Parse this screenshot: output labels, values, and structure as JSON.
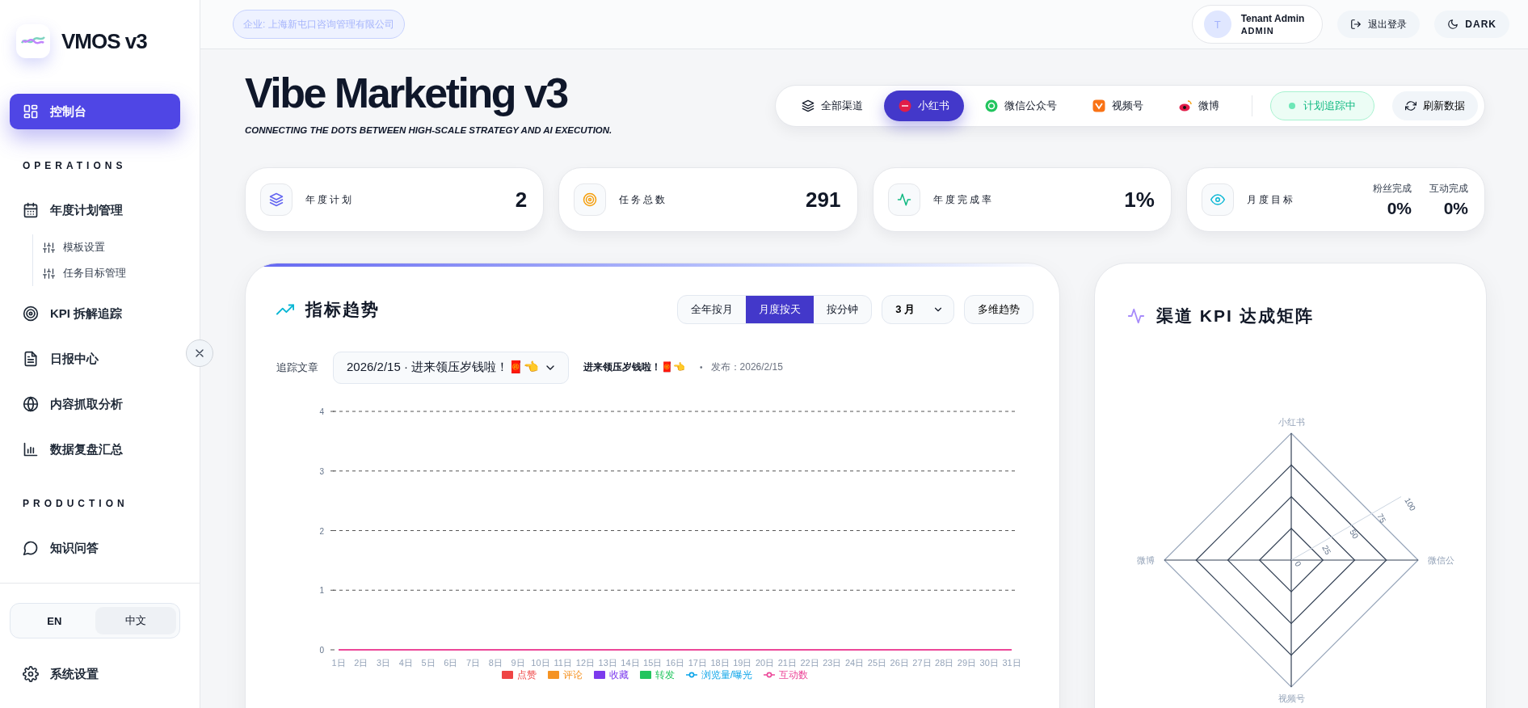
{
  "sidebar": {
    "logo": {
      "text": "VMOS v3"
    },
    "nav": [
      {
        "kind": "item",
        "label": "控制台",
        "selected": true
      },
      {
        "kind": "section",
        "label": "OPERATIONS"
      },
      {
        "kind": "item",
        "label": "年度计划管理",
        "selected": false,
        "children": [
          {
            "label": "模板设置",
            "selected": false
          },
          {
            "label": "任务目标管理",
            "selected": false
          }
        ]
      },
      {
        "kind": "item",
        "label": "KPI 拆解追踪",
        "selected": false
      },
      {
        "kind": "item",
        "label": "日报中心",
        "selected": false
      },
      {
        "kind": "item",
        "label": "内容抓取分析",
        "selected": false
      },
      {
        "kind": "item",
        "label": "数据复盘汇总",
        "selected": false
      },
      {
        "kind": "section",
        "label": "PRODUCTION"
      },
      {
        "kind": "item",
        "label": "知识问答",
        "selected": false
      }
    ],
    "languages": [
      {
        "label": "EN",
        "selected": false
      },
      {
        "label": "中文",
        "selected": true
      }
    ],
    "settings": {
      "label": "系统设置"
    }
  },
  "header": {
    "company": "企业: 上海新屯口咨询管理有限公司",
    "user": {
      "avatar": "T",
      "name": "Tenant Admin",
      "role": "ADMIN"
    },
    "logout": "退出登录",
    "theme": "DARK"
  },
  "hero": {
    "title": "Vibe Marketing v3",
    "subtitle": "CONNECTING THE DOTS BETWEEN HIGH-SCALE STRATEGY AND AI EXECUTION."
  },
  "channels": [
    {
      "label": "全部渠道",
      "selected": false
    },
    {
      "label": "小红书",
      "selected": true
    },
    {
      "label": "微信公众号",
      "selected": false
    },
    {
      "label": "视频号",
      "selected": false
    },
    {
      "label": "微博",
      "selected": false
    }
  ],
  "status": "计划追踪中",
  "refresh": "刷新数据",
  "stats": [
    {
      "kind": "single",
      "label": "年度计划",
      "value": "2"
    },
    {
      "kind": "single",
      "label": "任务总数",
      "value": "291"
    },
    {
      "kind": "single",
      "label": "年度完成率",
      "value": "1%"
    },
    {
      "kind": "split",
      "label": "月度目标",
      "parts": [
        {
          "label": "粉丝完成",
          "value": "0%"
        },
        {
          "label": "互动完成",
          "value": "0%"
        }
      ]
    }
  ],
  "trend": {
    "title": "指标趋势",
    "modes": [
      {
        "label": "全年按月",
        "selected": false
      },
      {
        "label": "月度按天",
        "selected": true
      },
      {
        "label": "按分钟",
        "selected": false
      }
    ],
    "month": "3 月",
    "multi": "多维趋势",
    "article": {
      "label": "追踪文章",
      "value": "2026/2/15 · 进来领压岁钱啦！🧧👈",
      "title": "进来领压岁钱啦！🧧👈",
      "separator": "•",
      "published": "发布：2026/2/15"
    },
    "chart_data": {
      "type": "line",
      "grid": true,
      "categories": [
        "1日",
        "2日",
        "3日",
        "4日",
        "5日",
        "6日",
        "7日",
        "8日",
        "9日",
        "10日",
        "11日",
        "12日",
        "13日",
        "14日",
        "15日",
        "16日",
        "17日",
        "18日",
        "19日",
        "20日",
        "21日",
        "22日",
        "23日",
        "24日",
        "25日",
        "26日",
        "27日",
        "28日",
        "29日",
        "30日",
        "31日"
      ],
      "ylim": [
        0,
        4
      ],
      "yticks": [
        0,
        1,
        2,
        3,
        4
      ],
      "series": [
        {
          "name": "点赞",
          "color": "#ef4444",
          "values": [
            null,
            null,
            null,
            null,
            null,
            null,
            null,
            null,
            null,
            null,
            null,
            null,
            null,
            null,
            null,
            null,
            null,
            null,
            null,
            null,
            null,
            null,
            null,
            null,
            null,
            null,
            null,
            null,
            null,
            null,
            null
          ]
        },
        {
          "name": "评论",
          "color": "#f59323",
          "values": [
            null,
            null,
            null,
            null,
            null,
            null,
            null,
            null,
            null,
            null,
            null,
            null,
            null,
            null,
            null,
            null,
            null,
            null,
            null,
            null,
            null,
            null,
            null,
            null,
            null,
            null,
            null,
            null,
            null,
            null,
            null
          ]
        },
        {
          "name": "收藏",
          "color": "#7c3aed",
          "values": [
            null,
            null,
            null,
            null,
            null,
            null,
            null,
            null,
            null,
            null,
            null,
            null,
            null,
            null,
            null,
            null,
            null,
            null,
            null,
            null,
            null,
            null,
            null,
            null,
            null,
            null,
            null,
            null,
            null,
            null,
            null
          ]
        },
        {
          "name": "转发",
          "color": "#22c55e",
          "values": [
            null,
            null,
            null,
            null,
            null,
            null,
            null,
            null,
            null,
            null,
            null,
            null,
            null,
            null,
            null,
            null,
            null,
            null,
            null,
            null,
            null,
            null,
            null,
            null,
            null,
            null,
            null,
            null,
            null,
            null,
            null
          ]
        },
        {
          "name": "浏览量/曝光",
          "color": "#0ea5e9",
          "values": [
            null,
            null,
            null,
            null,
            null,
            null,
            null,
            null,
            null,
            null,
            null,
            null,
            null,
            null,
            null,
            null,
            null,
            null,
            null,
            null,
            null,
            null,
            null,
            null,
            null,
            null,
            null,
            null,
            null,
            null,
            null
          ]
        },
        {
          "name": "互动数",
          "color": "#ec4899",
          "values": [
            0,
            0,
            0,
            0,
            0,
            0,
            0,
            0,
            0,
            0,
            0,
            0,
            0,
            0,
            0,
            0,
            0,
            0,
            0,
            0,
            0,
            0,
            0,
            0,
            0,
            0,
            0,
            0,
            0,
            0,
            0
          ]
        }
      ]
    }
  },
  "kpi_matrix": {
    "title": "渠道 KPI 达成矩阵",
    "axes": [
      "小红书",
      "微信公",
      "视频号",
      "微博"
    ],
    "ticks": [
      "0",
      "25",
      "50",
      "75",
      "100"
    ]
  }
}
